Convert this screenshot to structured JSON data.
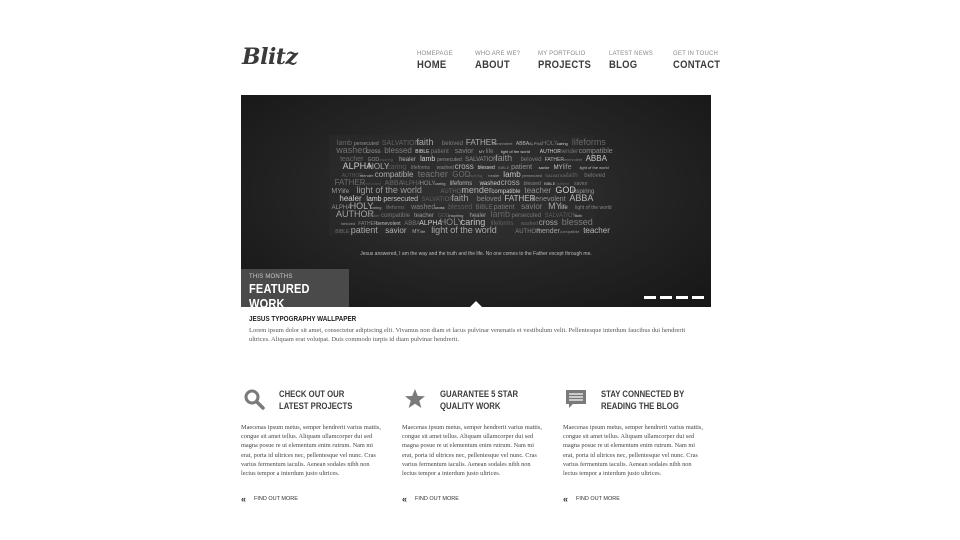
{
  "header": {
    "logo": "Blitz",
    "nav": [
      {
        "sub": "HOMEPAGE",
        "label": "HOME"
      },
      {
        "sub": "WHO ARE WE?",
        "label": "ABOUT"
      },
      {
        "sub": "MY PORTFOLIO",
        "label": "PROJECTS"
      },
      {
        "sub": "LATEST NEWS",
        "label": "BLOG"
      },
      {
        "sub": "GET IN TOUCH",
        "label": "CONTACT"
      }
    ]
  },
  "hero": {
    "kicker": "THIS MONTHS",
    "title": "FEATURED WORK",
    "quote": "Jesus answered,    I am the way and the truth and the life. No one comes to the Father except through me.",
    "slide_count": 4,
    "words": [
      "lamb",
      "persecuted",
      "SALVATION",
      "faith",
      "beloved",
      "FATHER",
      "benevolent",
      "ABBA",
      "ALPHA",
      "HOLY",
      "caring",
      "lifeforms",
      "washed",
      "cross",
      "blessed",
      "BIBLE",
      "patient",
      "savior",
      "MY",
      "life",
      "light of the world",
      "AUTHOR",
      "mender",
      "compatible",
      "teacher",
      "GOD",
      "inspiring",
      "healer"
    ]
  },
  "caption": {
    "title": "JESUS TYPOGRAPHY WALLPAPER",
    "text": "Lorem ipsum dolor sit amet, consectetur adipiscing elit. Vivamus non diam et lacus pulvinar venenatis et vestibulum velit. Pellentesque interdum faucibus dui hendrerit ultrices. Aliquam erat volutpat. Duis commodo turpis id diam pulvinar hendrerit."
  },
  "features": [
    {
      "icon": "search-icon",
      "title": "CHECK OUT OUR LATEST PROJECTS",
      "text": "Maecenas ipsum metus, semper hendrerit varius mattis, congue sit amet tellus. Aliquam ullamcorper dui sed magna posue re ut elementum enim rutrum. Nam mi erat, porta id ultrices nec, pellentesque vel nunc. Cras varius fermentum iaculis. Aenean sodales nibh non lectus tempor a interdum justo ultrices.",
      "more": "FIND OUT MORE"
    },
    {
      "icon": "star-icon",
      "title": "GUARANTEE 5 STAR QUALITY WORK",
      "text": "Maecenas ipsum metus, semper hendrerit varius mattis, congue sit amet tellus. Aliquam ullamcorper dui sed magna posue re ut elementum enim rutrum. Nam mi erat, porta id ultrices nec, pellentesque vel nunc. Cras varius fermentum iaculis. Aenean sodales nibh non lectus tempor a interdum justo ultrices.",
      "more": "FIND OUT MORE"
    },
    {
      "icon": "chat-bubble-icon",
      "title": "STAY CONNECTED BY READING THE BLOG",
      "text": "Maecenas ipsum metus, semper hendrerit varius mattis, congue sit amet tellus. Aliquam ullamcorper dui sed magna posue re ut elementum enim rutrum. Nam mi erat, porta id ultrices nec, pellentesque vel nunc. Cras varius fermentum iaculis. Aenean sodales nibh non lectus tempor a interdum justo ultrices.",
      "more": "FIND OUT MORE"
    }
  ],
  "colors": {
    "accent_dark": "#3c3c3c",
    "hero_bg": "#1e1e1e",
    "featured_box": "#4a4a4a",
    "icon_gray": "#7a7a7a"
  }
}
